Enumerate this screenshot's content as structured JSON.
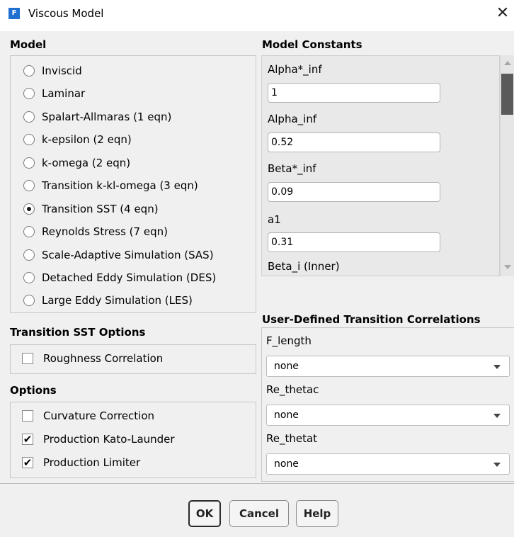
{
  "window": {
    "app_icon": "F",
    "title": "Viscous Model",
    "close_glyph": "✕"
  },
  "model": {
    "title": "Model",
    "options": [
      {
        "label": "Inviscid",
        "selected": false
      },
      {
        "label": "Laminar",
        "selected": false
      },
      {
        "label": "Spalart-Allmaras (1 eqn)",
        "selected": false
      },
      {
        "label": "k-epsilon (2 eqn)",
        "selected": false
      },
      {
        "label": "k-omega (2 eqn)",
        "selected": false
      },
      {
        "label": "Transition k-kl-omega (3 eqn)",
        "selected": false
      },
      {
        "label": "Transition SST (4 eqn)",
        "selected": true
      },
      {
        "label": "Reynolds Stress (7 eqn)",
        "selected": false
      },
      {
        "label": "Scale-Adaptive Simulation (SAS)",
        "selected": false
      },
      {
        "label": "Detached Eddy Simulation (DES)",
        "selected": false
      },
      {
        "label": "Large Eddy Simulation (LES)",
        "selected": false
      }
    ]
  },
  "transition_sst_options": {
    "title": "Transition SST Options",
    "roughness_correlation": {
      "label": "Roughness Correlation",
      "checked": false
    }
  },
  "options": {
    "title": "Options",
    "items": [
      {
        "label": "Curvature Correction",
        "checked": false
      },
      {
        "label": "Production Kato-Launder",
        "checked": true
      },
      {
        "label": "Production Limiter",
        "checked": true
      }
    ]
  },
  "model_constants": {
    "title": "Model Constants",
    "fields": [
      {
        "label": "Alpha*_inf",
        "value": "1"
      },
      {
        "label": "Alpha_inf",
        "value": "0.52"
      },
      {
        "label": "Beta*_inf",
        "value": "0.09"
      },
      {
        "label": "a1",
        "value": "0.31"
      },
      {
        "label": "Beta_i (Inner)"
      }
    ]
  },
  "udtc": {
    "title": "User-Defined Transition Correlations",
    "fields": [
      {
        "label": "F_length",
        "value": "none"
      },
      {
        "label": "Re_thetac",
        "value": "none"
      },
      {
        "label": "Re_thetat",
        "value": "none"
      }
    ]
  },
  "buttons": {
    "ok": "OK",
    "cancel": "Cancel",
    "help": "Help"
  },
  "icons": {
    "close": "close-icon",
    "check": "check-icon",
    "dropdown": "chevron-down-icon"
  },
  "colors": {
    "app_icon": "#1f6fd0",
    "background": "#f0f0f0",
    "scroll_thumb": "#5a5a5a"
  }
}
